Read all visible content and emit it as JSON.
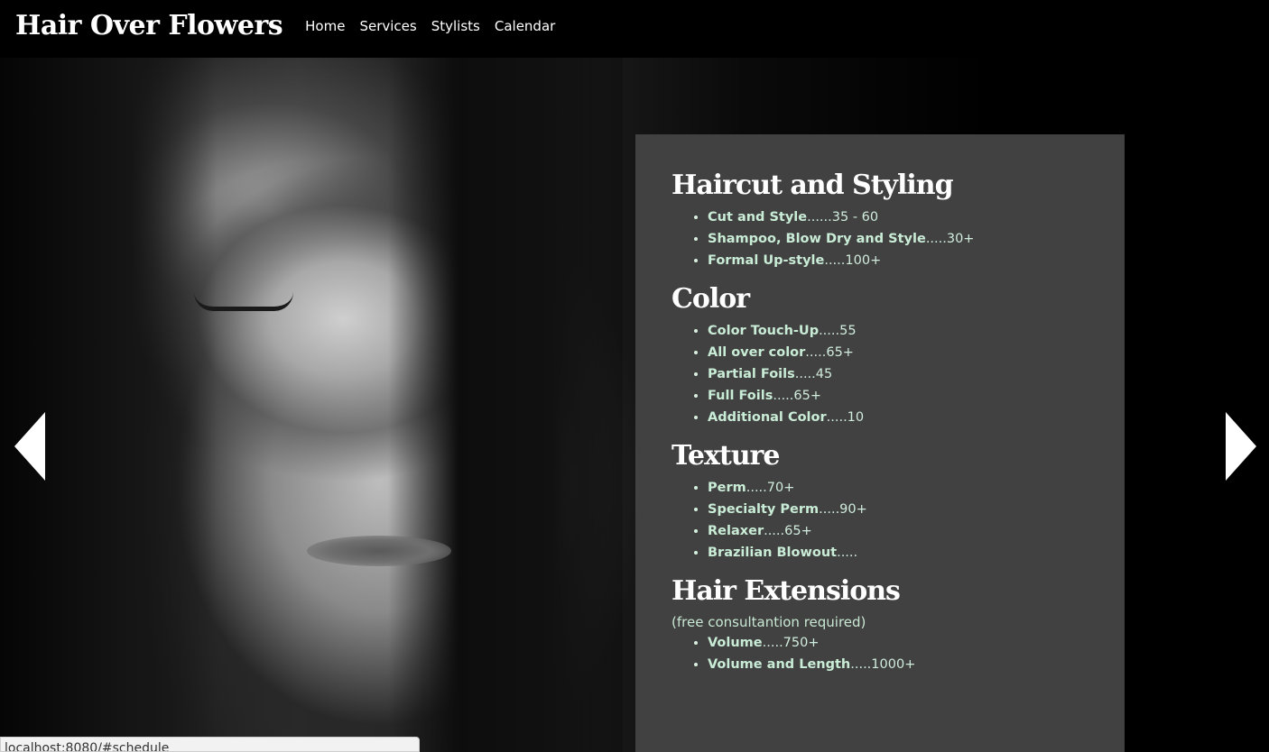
{
  "header": {
    "brand": "Hair Over Flowers",
    "nav": [
      "Home",
      "Services",
      "Stylists",
      "Calendar"
    ]
  },
  "services": [
    {
      "title": "Haircut and Styling",
      "note": "",
      "items": [
        {
          "name": "Cut and Style",
          "price": "......35 - 60"
        },
        {
          "name": "Shampoo, Blow Dry and Style",
          "price": ".....30+"
        },
        {
          "name": "Formal Up-style",
          "price": ".....100+"
        }
      ]
    },
    {
      "title": "Color",
      "note": "",
      "items": [
        {
          "name": "Color Touch-Up",
          "price": ".....55"
        },
        {
          "name": "All over color",
          "price": ".....65+"
        },
        {
          "name": "Partial Foils",
          "price": ".....45"
        },
        {
          "name": "Full Foils",
          "price": ".....65+"
        },
        {
          "name": "Additional Color",
          "price": ".....10"
        }
      ]
    },
    {
      "title": "Texture",
      "note": "",
      "items": [
        {
          "name": "Perm",
          "price": ".....70+"
        },
        {
          "name": "Specialty Perm",
          "price": ".....90+"
        },
        {
          "name": "Relaxer",
          "price": ".....65+"
        },
        {
          "name": "Brazilian Blowout",
          "price": "....."
        }
      ]
    },
    {
      "title": "Hair Extensions",
      "note": "(free consultantion required)",
      "items": [
        {
          "name": "Volume",
          "price": ".....750+"
        },
        {
          "name": "Volume and Length",
          "price": ".....1000+"
        }
      ]
    }
  ],
  "carousel": {
    "prev_icon": "chevron-left-icon",
    "next_icon": "chevron-right-icon"
  },
  "status_bar": {
    "url": "localhost:8080/#schedule"
  },
  "colors": {
    "panel_bg": "#444444",
    "item_text": "#c9ecd6",
    "header_bg": "#000000"
  }
}
